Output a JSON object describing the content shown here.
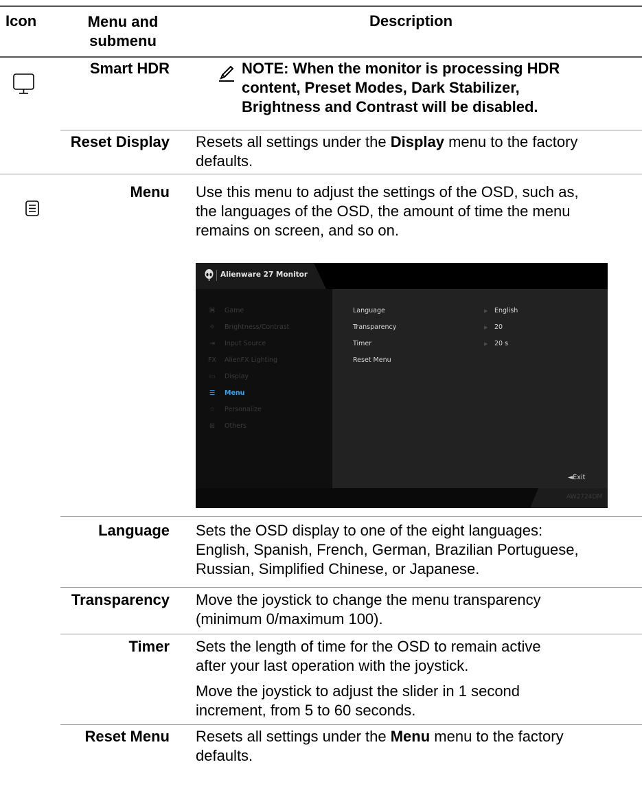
{
  "header": {
    "icon_col": "Icon",
    "menu_col_line1": "Menu and",
    "menu_col_line2": "submenu",
    "desc_col": "Description"
  },
  "rows": {
    "smart_hdr": {
      "label": "Smart HDR",
      "note_l1": "NOTE: When the monitor is processing HDR",
      "note_l2": "content, Preset Modes, Dark Stabilizer,",
      "note_l3": "Brightness and Contrast will be disabled."
    },
    "reset_display": {
      "label": "Reset Display",
      "d_l1_a": "Resets all settings under the ",
      "d_l1_b": "Display",
      "d_l1_c": " menu to the factory",
      "d_l2": "defaults."
    },
    "menu": {
      "label": "Menu",
      "d_l1": "Use this menu to adjust the settings of the OSD, such as,",
      "d_l2": "the languages of the OSD, the amount of time the menu",
      "d_l3": "remains on screen, and so on."
    },
    "language": {
      "label": "Language",
      "d_l1": "Sets the OSD display to one of the eight languages:",
      "d_l2": "English, Spanish, French, German, Brazilian Portuguese,",
      "d_l3": "Russian, Simplified Chinese, or Japanese."
    },
    "transparency": {
      "label": "Transparency",
      "d_l1": "Move the joystick to change the menu transparency",
      "d_l2": "(minimum 0/maximum 100)."
    },
    "timer": {
      "label": "Timer",
      "d_l1": "Sets the length of time for the OSD to remain active",
      "d_l2": "after your last operation with the joystick.",
      "d_l3": "Move the joystick to adjust the slider in 1 second",
      "d_l4": "increment, from 5 to 60 seconds."
    },
    "reset_menu": {
      "label": "Reset Menu",
      "d_l1_a": "Resets all settings under the ",
      "d_l1_b": "Menu",
      "d_l1_c": " menu to the factory",
      "d_l2": "defaults."
    }
  },
  "osd": {
    "title": "Alienware 27 Monitor",
    "model": "AW2724DM",
    "exit_label": "◄Exit",
    "accent_color": "#3aa0e6",
    "menu_items": [
      {
        "icon": "gamepad-icon",
        "glyph": "⌘",
        "label": "Game"
      },
      {
        "icon": "brightness-icon",
        "glyph": "☼",
        "label": "Brightness/Contrast"
      },
      {
        "icon": "input-source-icon",
        "glyph": "⇥",
        "label": "Input Source"
      },
      {
        "icon": "fx-icon",
        "glyph": "FX",
        "label": "AlienFX Lighting"
      },
      {
        "icon": "display-icon",
        "glyph": "▭",
        "label": "Display"
      },
      {
        "icon": "menu-icon",
        "glyph": "☰",
        "label": "Menu"
      },
      {
        "icon": "star-icon",
        "glyph": "☆",
        "label": "Personalize"
      },
      {
        "icon": "others-icon",
        "glyph": "⊞",
        "label": "Others"
      }
    ],
    "options": [
      {
        "label": "Language",
        "value": "English"
      },
      {
        "label": "Transparency",
        "value": "20"
      },
      {
        "label": "Timer",
        "value": "20 s"
      },
      {
        "label": "Reset Menu",
        "value": ""
      }
    ]
  }
}
